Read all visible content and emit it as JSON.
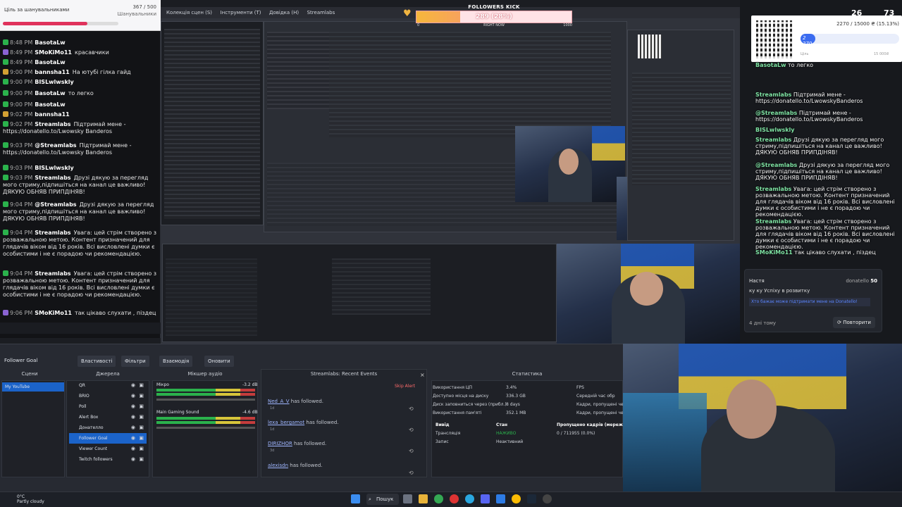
{
  "chat": {
    "goal_title": "Ціль за шанувальниками",
    "goal_count": "367 / 500",
    "goal_sub": "Шанувальники",
    "goal_progress": 0.734,
    "lines": [
      {
        "time": "8:48 PM",
        "user": "BasotaLw",
        "msg": ""
      },
      {
        "time": "8:49 PM",
        "user": "SMoKiMo11",
        "msg": "красавчики"
      },
      {
        "time": "8:49 PM",
        "user": "BasotaLw",
        "msg": ""
      },
      {
        "time": "9:00 PM",
        "user": "bannsha11",
        "msg": "На ютубі гілка гайд"
      },
      {
        "time": "9:00 PM",
        "user": "BISLwlwskly",
        "msg": ""
      },
      {
        "time": "9:00 PM",
        "user": "BasotaLw",
        "msg": "то легко"
      },
      {
        "time": "9:00 PM",
        "user": "BasotaLw",
        "msg": ""
      },
      {
        "time": "9:02 PM",
        "user": "bannsha11",
        "msg": ""
      },
      {
        "time": "9:02 PM",
        "user": "Streamlabs",
        "msg": "Підтримай мене - https://donatello.to/Lwowsky Banderos"
      },
      {
        "time": "9:03 PM",
        "user": "@Streamlabs",
        "msg": "Підтримай мене - https://donatello.to/Lwowsky Banderos"
      },
      {
        "time": "9:03 PM",
        "user": "BISLwlwskly",
        "msg": ""
      },
      {
        "time": "9:03 PM",
        "user": "Streamlabs",
        "msg": "Друзі дякую за перегляд мого стриму,підпишіться на канал це важливо!ДЯКУЮ ОБНЯВ ПРИПДІНЯВ!"
      },
      {
        "time": "9:04 PM",
        "user": "@Streamlabs",
        "msg": "Друзі дякую за перегляд мого стриму,підпишіться на канал це важливо!ДЯКУЮ ОБНЯВ ПРИПДІНЯВ!"
      },
      {
        "time": "9:04 PM",
        "user": "Streamlabs",
        "msg": "Увага: цей стрім створено з розважальною метою. Контент призначений для глядачів віком від 16 років. Всі висловлені думки є особистими і не є порадою чи рекомендацією."
      },
      {
        "time": "9:04 PM",
        "user": "Streamlabs",
        "msg": "Увага: цей стрім створено з розважальною метою. Контент призначений для глядачів віком від 16 років. Всі висловлені думки є особистими і не є порадою чи рекомендацією."
      },
      {
        "time": "9:06 PM",
        "user": "SMoKiMo11",
        "msg": "так цікаво слухати , пiздец"
      }
    ]
  },
  "studio_menu": [
    "Колекція сцен (S)",
    "Інструменти (T)",
    "Довідка (H)",
    "Streamlabs"
  ],
  "followers_kick": {
    "label": "FOLLOWERS KICK",
    "value": "289 (28%)",
    "progress": 0.28,
    "min": "0",
    "now_label": "RIGHT NOW",
    "max": "1000"
  },
  "donate_goal": {
    "text": "2270 / 15000 ₴ (15.13%)",
    "current": "2 270",
    "progress": 0.1513,
    "min_label": "Ціль",
    "max_label": "15 000₴"
  },
  "top_stats": {
    "a": "26",
    "b": "73"
  },
  "right_chat": [
    {
      "user": "BasotaLw",
      "msg": "то легко"
    },
    {
      "user": "Streamlabs",
      "msg": "Підтримай мене - https://donatello.to/LwowskyBanderos"
    },
    {
      "user": "@Streamlabs",
      "msg": "Підтримай мене - https://donatello.to/LwowskyBanderos"
    },
    {
      "user": "BISLwlwskly",
      "msg": ""
    },
    {
      "user": "Streamlabs",
      "msg": "Друзі дякую за перегляд мого стриму,підпишіться на канал це важливо! ДЯКУЮ ОБНЯВ ПРИПДІНЯВ!"
    },
    {
      "user": "@Streamlabs",
      "msg": "Друзі дякую за перегляд мого стриму,підпишіться на канал це важливо! ДЯКУЮ ОБНЯВ ПРИПДІНЯВ!"
    },
    {
      "user": "Streamlabs",
      "msg": "Увага: цей стрім створено з розважальною метою. Контент призначений для глядачів віком від 16 років. Всі висловлені думки є особистими і не є порадою чи рекомендацією."
    },
    {
      "user": "Streamlabs",
      "msg": "Увага: цей стрім створено з розважальною метою. Контент призначений для глядачів віком від 16 років. Всі висловлені думки є особистими і не є порадою чи рекомендацією."
    },
    {
      "user": "SMoKiMo11",
      "msg": "так цікаво слухати , пiздец"
    }
  ],
  "alert": {
    "name": "Настя",
    "source": "donatello",
    "amount": "50",
    "message": "ку ку Успіху в розвитку",
    "hint": "Хто бажає може підтримати мене на Donatello!",
    "ago": "4 дні тому",
    "repeat_label": "Повторити"
  },
  "dock": {
    "scene_name": "Follower Goal",
    "tabs": [
      "Властивості",
      "Фільтри",
      "Взаємодія",
      "Оновити"
    ],
    "panes": {
      "scenes": "Сцени",
      "sources": "Джерела",
      "mixer": "Мікшер аудіо",
      "events": "Streamlabs: Recent Events",
      "stats": "Статистика"
    },
    "scenes": [
      "My YouTube"
    ],
    "sources": [
      "QR",
      "BRIO",
      "Poll",
      "Alert Box",
      "Донателло",
      "Follower Goal",
      "Viewer Count",
      "Twitch followers"
    ],
    "selected_source": 5,
    "mixer": [
      {
        "name": "Мікро",
        "db": "-3.2 dB"
      },
      {
        "name": "Main Gaming Sound",
        "db": "-4.6 dB"
      }
    ],
    "events": [
      {
        "who": "Ned_A_V",
        "text": " has followed.",
        "time": "1d"
      },
      {
        "who": "lexa_bergamot",
        "text": " has followed.",
        "time": "1d"
      },
      {
        "who": "DIRIZHOR",
        "text": " has followed.",
        "time": "3d"
      },
      {
        "who": "alexisdn",
        "text": " has followed.",
        "time": ""
      }
    ],
    "skip_alert": "Skip Alert",
    "stats": [
      {
        "k": "Використання ЦП",
        "v": "3.4%"
      },
      {
        "k": "Доступно місця на диску",
        "v": "336.3 GB"
      },
      {
        "k": "Диск заповниться через (прибл.)",
        "v": "8 days"
      },
      {
        "k": "Використання пам'яті",
        "v": "352.1 MB"
      }
    ],
    "stats_right": [
      "FPS",
      "Середній час обр",
      "Кадри, пропущені че",
      "Кадри, пропущені че"
    ],
    "output_headers": [
      "Вивід",
      "Стан",
      "Пропущено кадрів (мережа)"
    ],
    "outputs": [
      {
        "name": "Трансляція",
        "state": "НАЖИВО",
        "dropped": "0 / 711955 (0.0%)"
      },
      {
        "name": "Запис",
        "state": "Неактивний",
        "dropped": ""
      }
    ]
  },
  "taskbar": {
    "weather_temp": "0°C",
    "weather_desc": "Partly cloudy",
    "search": "Пошук"
  },
  "colors": {
    "accent": "#1b63c9",
    "live": "#2bb24c",
    "donate": "#3b6cf0",
    "kick": "#f6b73c"
  }
}
